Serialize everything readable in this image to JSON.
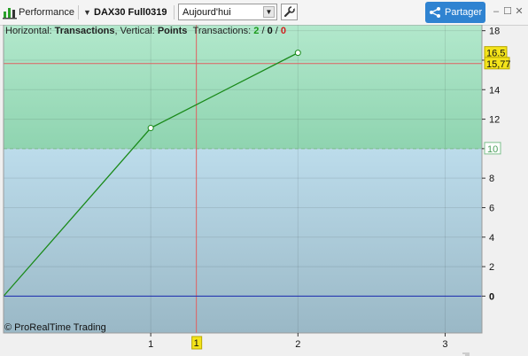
{
  "toolbar": {
    "panel_label": "Performance",
    "instrument": "DAX30 Full0319",
    "period_value": "Aujourd'hui",
    "share_label": "Partager",
    "minimize_glyph": "–",
    "maximize_glyph": "☐",
    "close_glyph": "✕"
  },
  "info_bar": {
    "horizontal_label": "Horizontal:",
    "horizontal_value": "Transactions",
    "vertical_label": ", Vertical:",
    "vertical_value": "Points",
    "transactions_label": "Transactions:",
    "wins": "2",
    "neutral": "0",
    "losses": "0",
    "slash": "/"
  },
  "copyright": "© ProRealTime Trading",
  "colors": {
    "positive_zone": "#a6e0c0",
    "negative_zone": "#b8d4e2",
    "line": "#1a8a1a",
    "zero_line": "#1a2ab0",
    "cursor": "#e06060",
    "price_tag": "#f4e41a"
  },
  "chart_data": {
    "type": "line",
    "title": "",
    "xlabel": "Transactions",
    "ylabel": "Points",
    "x": [
      0,
      1,
      2
    ],
    "values": [
      0,
      11.4,
      16.5
    ],
    "xlim": [
      0,
      3.25
    ],
    "ylim": [
      -2.5,
      18.4
    ],
    "x_ticks": [
      1,
      2,
      3
    ],
    "y_ticks": [
      0,
      2,
      4,
      6,
      8,
      10,
      12,
      14,
      16,
      18
    ],
    "markers_at": [
      1,
      2
    ],
    "last_value_label": "16.5",
    "cursor_value_label": "15,77",
    "cursor_value": 15.77,
    "zone_threshold": 10,
    "zone_threshold_label": "10",
    "cursor_x": 1.31,
    "cursor_x_label": "1",
    "zero_line": 0,
    "grid": true
  }
}
